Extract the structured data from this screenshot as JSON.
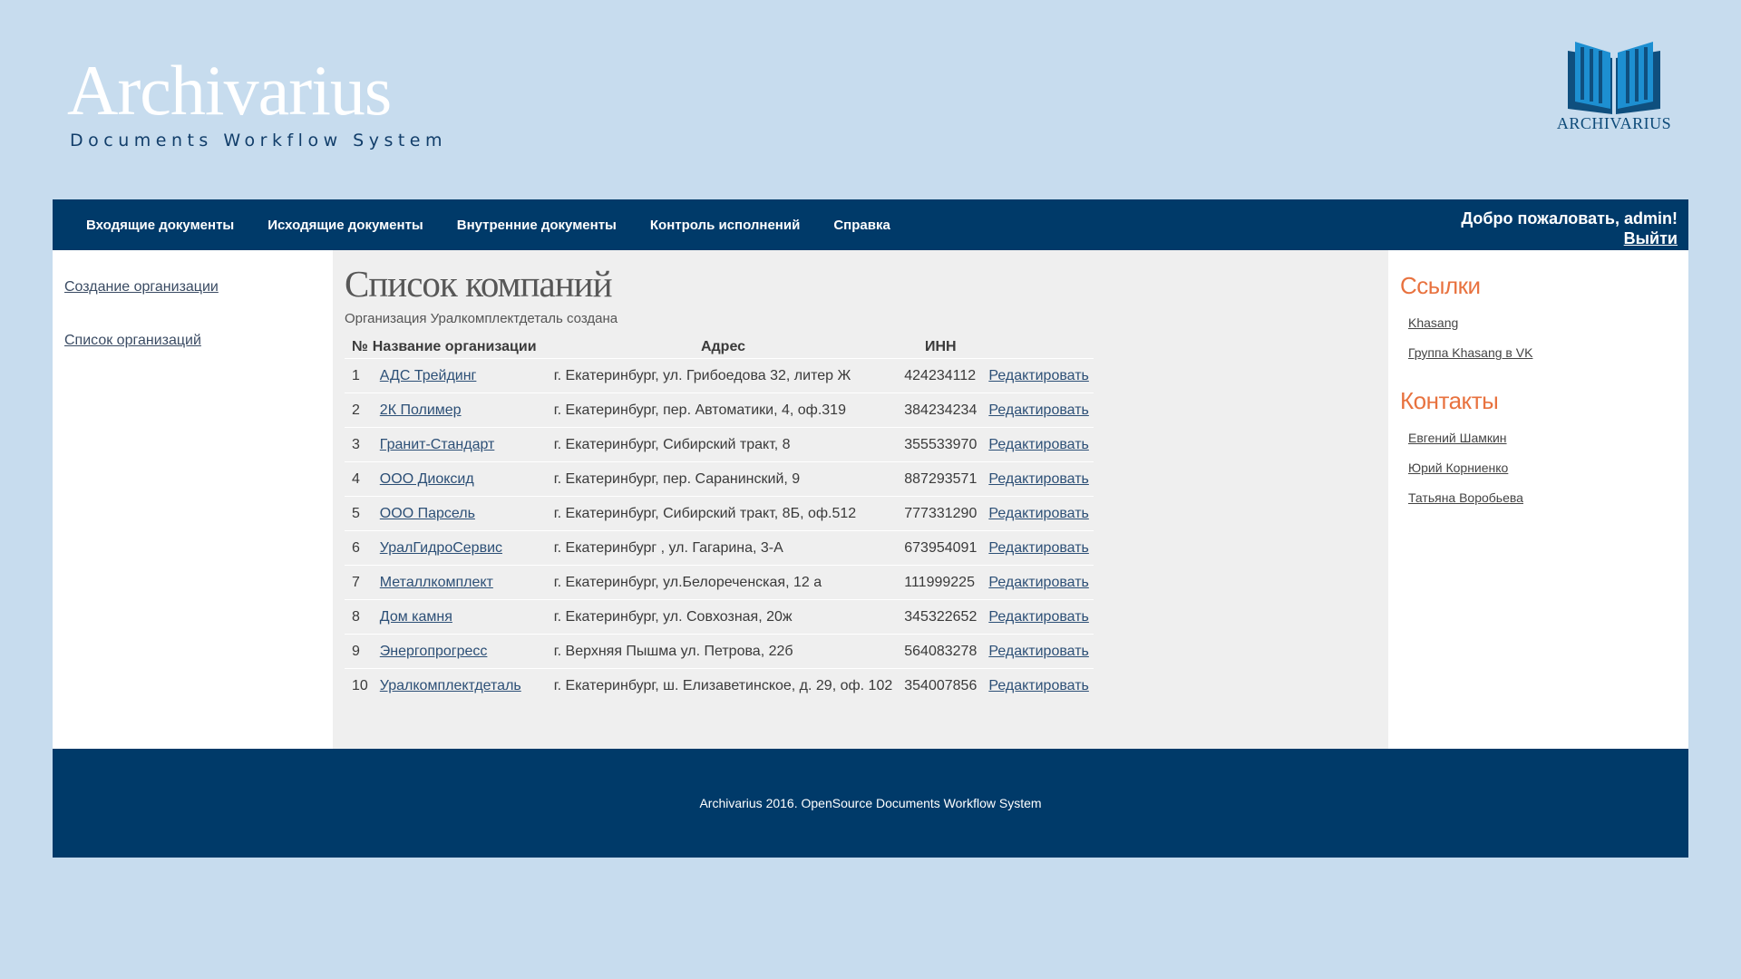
{
  "brand": {
    "title": "Archivarius",
    "subtitle": "Documents Workflow System",
    "logo_text": "ARCHIVARIUS",
    "logo_icon": "open-book-icon"
  },
  "colors": {
    "page_bg": "#c7dcee",
    "nav_bg": "#003a69",
    "accent": "#e8723f",
    "link": "#2c4f76"
  },
  "nav": {
    "items": [
      "Входящие документы",
      "Исходящие документы",
      "Внутренние документы",
      "Контроль исполнений",
      "Справка"
    ],
    "welcome": "Добро пожаловать, admin!",
    "logout": "Выйти"
  },
  "left_sidebar": {
    "links": [
      "Создание организации",
      "Список организаций"
    ]
  },
  "main": {
    "title": "Список компаний",
    "status": "Организация Уралкомплектдеталь создана",
    "columns": [
      "№",
      "Название организации",
      "Адрес",
      "ИНН"
    ],
    "edit_label": "Редактировать",
    "rows": [
      {
        "num": "1",
        "name": "АДС Трейдинг",
        "address": "г. Екатеринбург, ул. Грибоедова 32, литер Ж",
        "inn": "424234112"
      },
      {
        "num": "2",
        "name": "2К Полимер",
        "address": "г. Екатеринбург, пер. Автоматики, 4, оф.319",
        "inn": "384234234"
      },
      {
        "num": "3",
        "name": "Гранит-Стандарт",
        "address": "г. Екатеринбург, Сибирский тракт, 8",
        "inn": "355533970"
      },
      {
        "num": "4",
        "name": "ООО Диоксид",
        "address": "г. Екатеринбург, пер. Саранинский, 9",
        "inn": "887293571"
      },
      {
        "num": "5",
        "name": "ООО Парсель",
        "address": "г. Екатеринбург, Сибирский тракт, 8Б, оф.512",
        "inn": "777331290"
      },
      {
        "num": "6",
        "name": "УралГидроСервис",
        "address": "г. Екатеринбург , ул. Гагарина, 3-А",
        "inn": "673954091"
      },
      {
        "num": "7",
        "name": "Металлкомплект",
        "address": "г. Екатеринбург, ул.Белореченская, 12 а",
        "inn": "111999225"
      },
      {
        "num": "8",
        "name": "Дом камня",
        "address": "г. Екатеринбург, ул. Совхозная, 20ж",
        "inn": "345322652"
      },
      {
        "num": "9",
        "name": "Энергопрогресс",
        "address": "г. Верхняя Пышма ул. Петрова, 22б",
        "inn": "564083278"
      },
      {
        "num": "10",
        "name": "Уралкомплектдеталь",
        "address": "г. Екатеринбург, ш. Елизаветинское, д. 29, оф. 102",
        "inn": "354007856"
      }
    ]
  },
  "right_sidebar": {
    "links_heading": "Ссылки",
    "links": [
      "Khasang",
      "Группа Khasang в VK"
    ],
    "contacts_heading": "Контакты",
    "contacts": [
      "Евгений Шамкин",
      "Юрий Корниенко",
      "Татьяна Воробьева"
    ]
  },
  "footer": {
    "text": "Archivarius 2016. OpenSource Documents Workflow System"
  }
}
